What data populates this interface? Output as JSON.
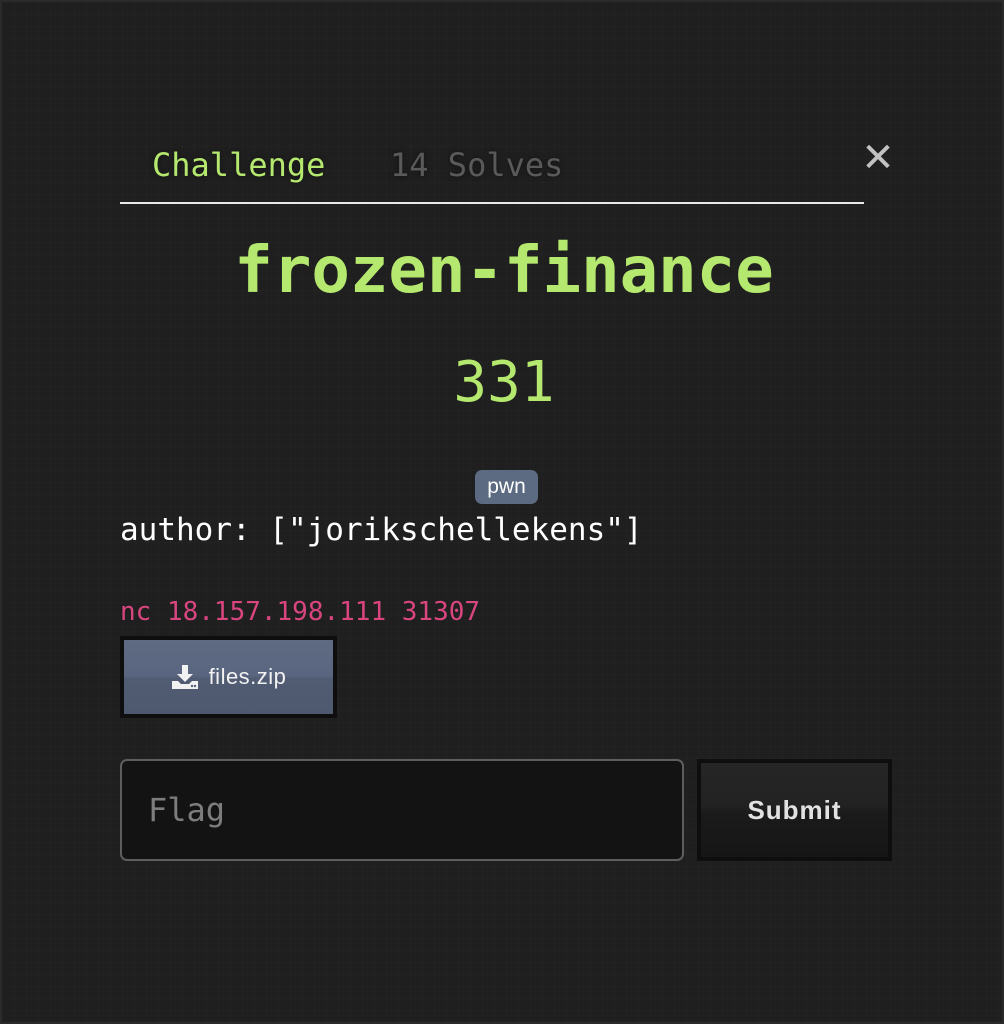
{
  "tabs": [
    {
      "label": "Challenge"
    },
    {
      "label": "14 Solves"
    }
  ],
  "close_label": "✕",
  "challenge": {
    "name": "frozen-finance",
    "points": "331",
    "tag": "pwn",
    "description_author": "author: [\"jorikschellekens\"]",
    "connection": "nc 18.157.198.111 31307"
  },
  "files": [
    {
      "name": "files.zip",
      "icon": "download-icon"
    }
  ],
  "flag": {
    "placeholder": "Flag",
    "submit_label": "Submit"
  },
  "colors": {
    "accent": "#b5e86e",
    "connection": "#d9457f",
    "tag_bg": "#5c6a82"
  }
}
